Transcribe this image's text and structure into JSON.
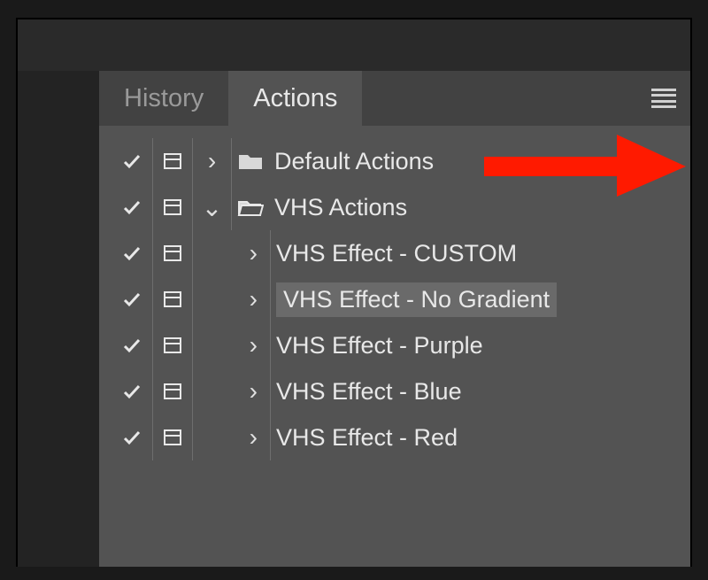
{
  "tabs": {
    "history": "History",
    "actions": "Actions"
  },
  "colors": {
    "annotation": "#ff1a00"
  },
  "rows": [
    {
      "checked": true,
      "hasDialog": true,
      "expand": "collapsed",
      "indent": false,
      "icon": "folder-closed",
      "label": "Default Actions",
      "selected": false
    },
    {
      "checked": true,
      "hasDialog": true,
      "expand": "expanded",
      "indent": false,
      "icon": "folder-open",
      "label": "VHS Actions",
      "selected": false
    },
    {
      "checked": true,
      "hasDialog": true,
      "expand": "collapsed",
      "indent": true,
      "icon": "none",
      "label": "VHS Effect - CUSTOM",
      "selected": false
    },
    {
      "checked": true,
      "hasDialog": true,
      "expand": "collapsed",
      "indent": true,
      "icon": "none",
      "label": "VHS Effect - No Gradient",
      "selected": true
    },
    {
      "checked": true,
      "hasDialog": true,
      "expand": "collapsed",
      "indent": true,
      "icon": "none",
      "label": "VHS Effect - Purple",
      "selected": false
    },
    {
      "checked": true,
      "hasDialog": true,
      "expand": "collapsed",
      "indent": true,
      "icon": "none",
      "label": "VHS Effect - Blue",
      "selected": false
    },
    {
      "checked": true,
      "hasDialog": true,
      "expand": "collapsed",
      "indent": true,
      "icon": "none",
      "label": "VHS Effect - Red",
      "selected": false
    }
  ]
}
